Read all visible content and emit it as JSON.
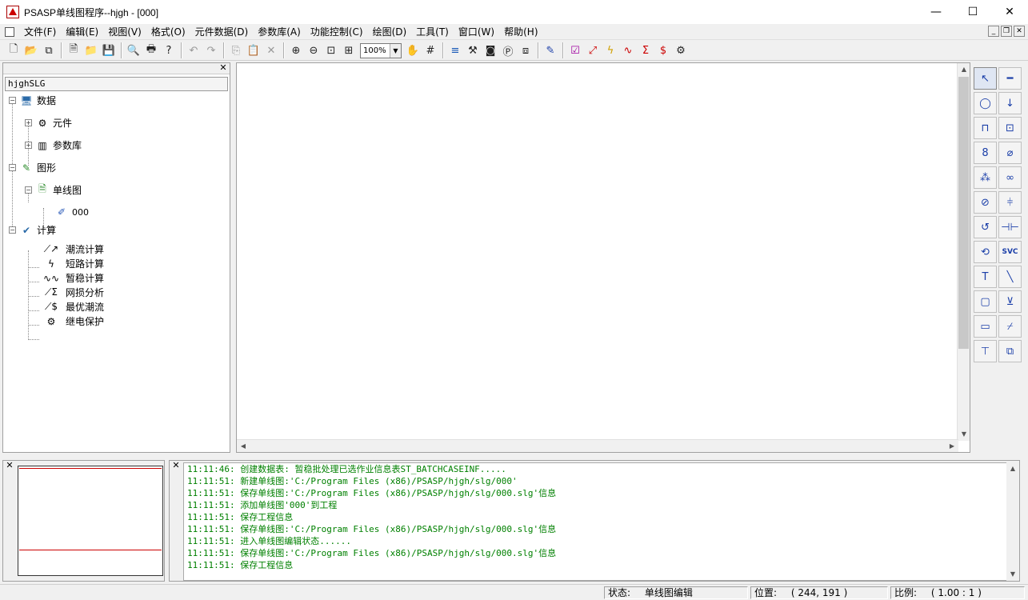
{
  "window": {
    "title": "PSASP单线图程序--hjgh - [000]",
    "min": "—",
    "max": "☐",
    "close": "✕"
  },
  "menu": [
    "文件(F)",
    "编辑(E)",
    "视图(V)",
    "格式(O)",
    "元件数据(D)",
    "参数库(A)",
    "功能控制(C)",
    "绘图(D)",
    "工具(T)",
    "窗口(W)",
    "帮助(H)"
  ],
  "toolbar": {
    "zoom": "100%"
  },
  "tree": {
    "root": "hjghSLG",
    "data": "数据",
    "components": "元件",
    "param_lib": "参数库",
    "graphics": "图形",
    "single_line": "单线图",
    "diagram_000": "000",
    "calc": "计算",
    "power_flow": "潮流计算",
    "short_circuit": "短路计算",
    "transient": "暂稳计算",
    "loss_analysis": "网损分析",
    "optimal_flow": "最优潮流",
    "relay": "继电保护"
  },
  "palette": {
    "svc": "SVC"
  },
  "log": [
    "11:11:46: 创建数据表: 暂稳批处理已选作业信息表ST_BATCHCASEINF.....",
    "11:11:51: 新建单线图:'C:/Program Files (x86)/PSASP/hjgh/slg/000'",
    "11:11:51: 保存单线图:'C:/Program Files (x86)/PSASP/hjgh/slg/000.slg'信息",
    "11:11:51: 添加单线图'000'到工程",
    "11:11:51: 保存工程信息",
    "11:11:51: 保存单线图:'C:/Program Files (x86)/PSASP/hjgh/slg/000.slg'信息",
    "11:11:51: 进入单线图编辑状态......",
    "11:11:51: 保存单线图:'C:/Program Files (x86)/PSASP/hjgh/slg/000.slg'信息",
    "11:11:51: 保存工程信息"
  ],
  "status": {
    "state_label": "状态:",
    "state_value": "单线图编辑",
    "pos_label": "位置:",
    "pos_value": "( 244, 191 )",
    "scale_label": "比例:",
    "scale_value": "( 1.00 : 1 )"
  },
  "colors": {
    "log_text": "#008000",
    "palette_icon": "#1a3ea8",
    "preview_frame": "#cc0000"
  }
}
